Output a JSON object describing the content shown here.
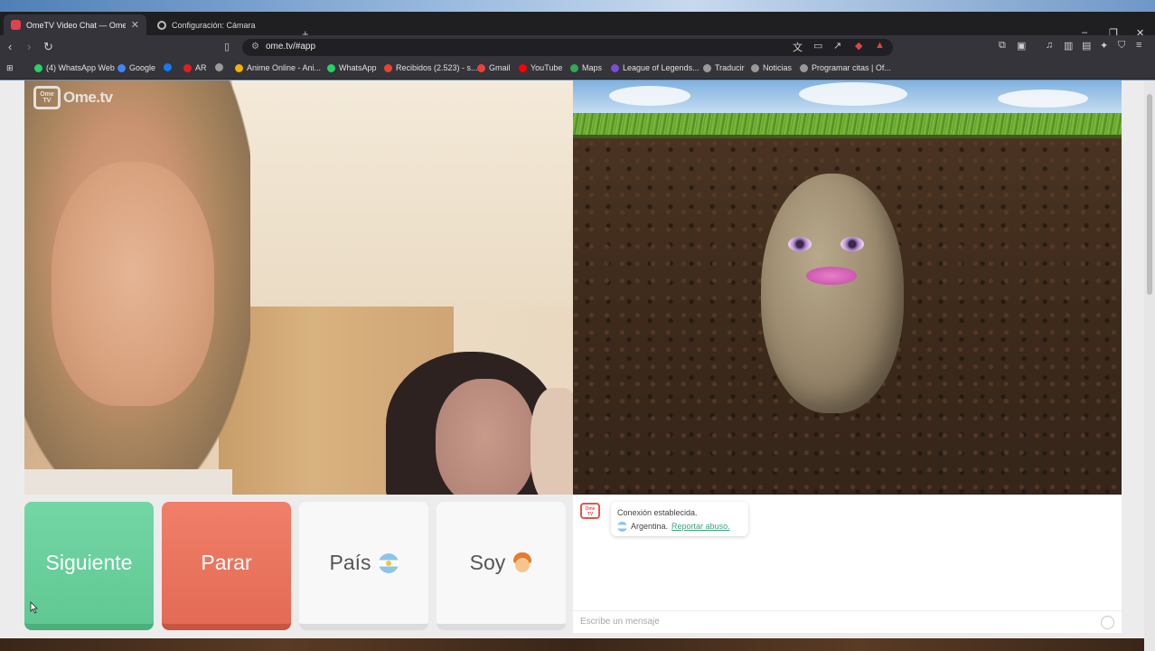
{
  "browser": {
    "tabs": [
      {
        "title": "OmeTV Video Chat — Omeg",
        "active": true
      },
      {
        "title": "Configuración: Cámara",
        "active": false
      }
    ],
    "new_tab_label": "+",
    "window_controls": {
      "minimize": "–",
      "restore": "❐",
      "close": "✕"
    },
    "url": "ome.tv/#app",
    "bookmarks": [
      {
        "label": "(4) WhatsApp Web",
        "color": "#25d366"
      },
      {
        "label": "Google",
        "color": "#4285f4"
      },
      {
        "label": "",
        "color": "#1877f2"
      },
      {
        "label": "AR",
        "color": "#e02020"
      },
      {
        "label": "",
        "color": "#9a9a9a"
      },
      {
        "label": "Anime Online - Ani...",
        "color": "#f2b400"
      },
      {
        "label": "WhatsApp",
        "color": "#25d366"
      },
      {
        "label": "Recibidos (2.523) - s...",
        "color": "#ea4335"
      },
      {
        "label": "Gmail",
        "color": "#ea4335"
      },
      {
        "label": "YouTube",
        "color": "#ff0000"
      },
      {
        "label": "Maps",
        "color": "#34a853"
      },
      {
        "label": "League of Legends...",
        "color": "#7a4dd6"
      },
      {
        "label": "Traducir",
        "color": "#9a9a9a"
      },
      {
        "label": "Noticias",
        "color": "#9a9a9a"
      },
      {
        "label": "Programar citas | Of...",
        "color": "#9a9a9a"
      }
    ]
  },
  "app": {
    "logo_text": "Ome.tv",
    "logo_badge": "Ome TV",
    "controls": {
      "next_label": "Siguiente",
      "stop_label": "Parar",
      "country_label": "País",
      "gender_label": "Soy"
    },
    "chat": {
      "system_message": "Conexión establecida.",
      "country": "Argentina.",
      "report_link": "Reportar abuso.",
      "input_placeholder": "Escribe un mensaje"
    },
    "colors": {
      "next": "#66cc99",
      "stop": "#e8715b",
      "link": "#3aa57a"
    }
  }
}
